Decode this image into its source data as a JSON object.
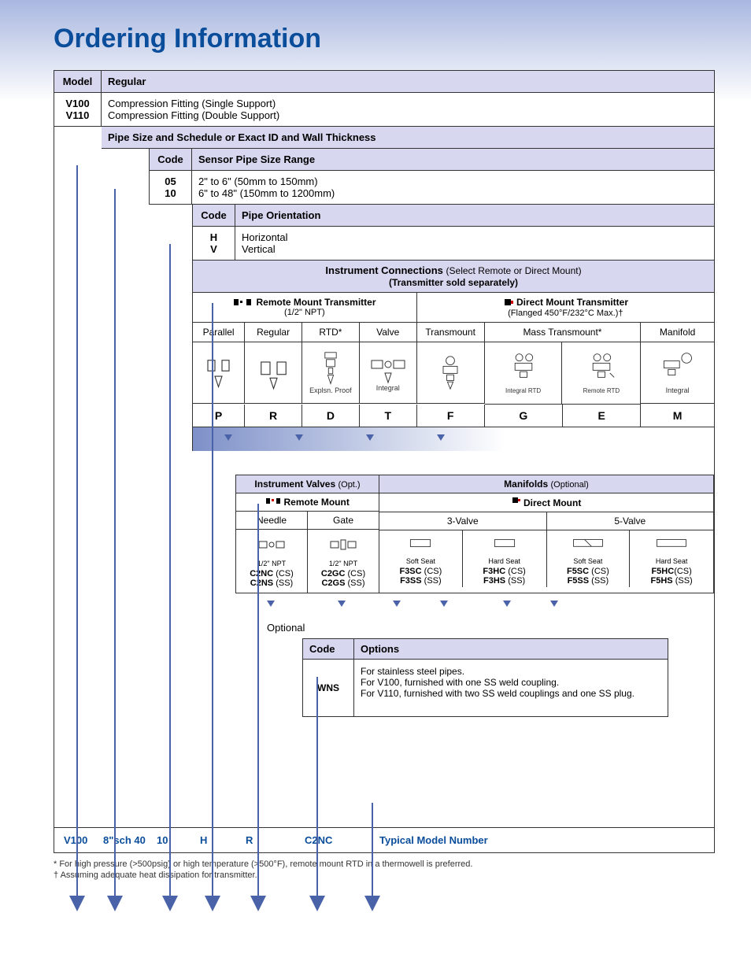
{
  "title": "Ordering Information",
  "headers": {
    "model": "Model",
    "regular": "Regular"
  },
  "model": {
    "v100": "V100",
    "v110": "V110"
  },
  "fitting": {
    "single": "Compression Fitting (Single Support)",
    "double": "Compression Fitting (Double Support)"
  },
  "pipe_band": "Pipe Size and Schedule or Exact ID and Wall Thickness",
  "code_label": "Code",
  "sensor_range_label": "Sensor Pipe Size Range",
  "sensor": {
    "c05": "05",
    "c10": "10",
    "r05": "2\" to 6\" (50mm to 150mm)",
    "r10": "6\" to 48\" (150mm to 1200mm)"
  },
  "orient_label": "Pipe Orientation",
  "orient": {
    "h": "H",
    "v": "V",
    "hdesc": "Horizontal",
    "vdesc": "Vertical"
  },
  "conn": {
    "title": "Instrument Connections",
    "subtitle1": "(Select Remote or Direct Mount)",
    "subtitle2": "(Transmitter sold separately)",
    "remote": "Remote Mount Transmitter",
    "remote_sub": "(1/2\" NPT)",
    "direct": "Direct Mount Transmitter",
    "direct_sub": "(Flanged 450°F/232°C Max.)†",
    "cols": {
      "parallel": "Parallel",
      "regular": "Regular",
      "rtd": "RTD*",
      "valve": "Valve",
      "transmount": "Transmount",
      "mass": "Mass Transmount*",
      "manifold": "Manifold"
    },
    "notes": {
      "explsn": "Explsn. Proof",
      "integral": "Integral",
      "integral_rtd": "Integral RTD",
      "remote_rtd": "Remote RTD"
    },
    "letters": {
      "p": "P",
      "r": "R",
      "d": "D",
      "t": "T",
      "f": "F",
      "g": "G",
      "e": "E",
      "m": "M"
    }
  },
  "valves": {
    "inst_title": "Instrument Valves",
    "inst_sub": "(Opt.)",
    "man_title": "Manifolds",
    "man_sub": "(Optional)",
    "remote": "Remote Mount",
    "direct": "Direct Mount",
    "needle": "Needle",
    "gate": "Gate",
    "v3": "3-Valve",
    "v5": "5-Valve",
    "half_npt": "1/2\" NPT",
    "soft": "Soft Seat",
    "hard": "Hard Seat",
    "codes": {
      "c2nc": "C2NC",
      "c2ns": "C2NS",
      "c2gc": "C2GC",
      "c2gs": "C2GS",
      "f3sc": "F3SC",
      "f3ss": "F3SS",
      "f3hc": "F3HC",
      "f3hs": "F3HS",
      "f5sc": "F5SC",
      "f5ss": "F5SS",
      "f5hc": "F5HC",
      "f5hs": "F5HS"
    },
    "cs": "(CS)",
    "ss": "(SS)"
  },
  "optional": "Optional",
  "options": {
    "code_hdr": "Code",
    "opt_hdr": "Options",
    "wns": "WNS",
    "desc1": "For stainless steel pipes.",
    "desc2": "For V100, furnished with one SS weld coupling.",
    "desc3": "For V110, furnished with two SS weld couplings and one SS plug."
  },
  "typical": {
    "v100": "V100",
    "pipe": "8\"sch 40",
    "c10": "10",
    "h": "H",
    "r": "R",
    "c2nc": "C2NC",
    "label": "Typical Model Number"
  },
  "footnotes": {
    "f1": "* For high pressure (>500psig) or high temperature (>500°F), remote mount RTD in a thermowell is preferred.",
    "f2": "† Assuming adequate heat dissipation for transmitter."
  }
}
